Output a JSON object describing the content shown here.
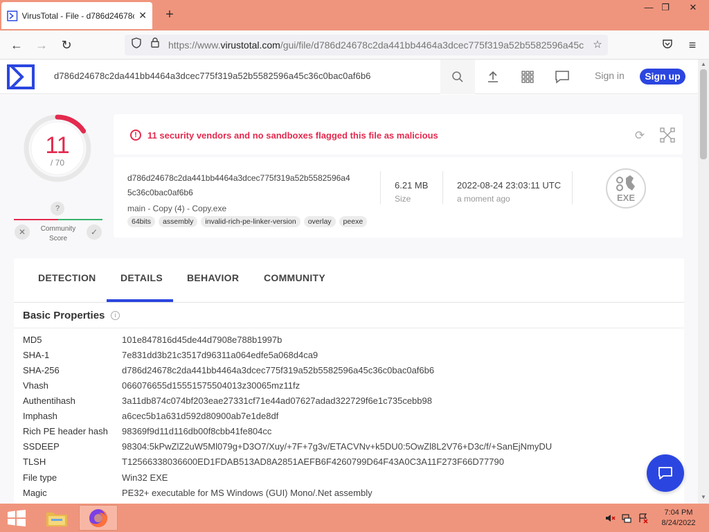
{
  "browser": {
    "tab_title": "VirusTotal - File - d786d24678c2",
    "url_prefix": "https://www.",
    "url_domain": "virustotal.com",
    "url_path": "/gui/file/d786d24678c2da441bb4464a3dcec775f319a52b5582596a45c",
    "window_controls": [
      "—",
      "❐",
      "✕"
    ]
  },
  "header": {
    "search_value": "d786d24678c2da441bb4464a3dcec775f319a52b5582596a45c36c0bac0af6b6",
    "sign_in": "Sign in",
    "sign_up": "Sign up"
  },
  "score": {
    "detections": "11",
    "total": "/ 70",
    "detection_fraction": 0.157,
    "community_question": "?",
    "community_label": "Community Score"
  },
  "alert": {
    "text": "11 security vendors and no sandboxes flagged this file as malicious"
  },
  "file": {
    "hash_line1": "d786d24678c2da441bb4464a3dcec775f319a52b5582596a4",
    "hash_line2": "5c36c0bac0af6b6",
    "name": "main - Copy (4) - Copy.exe",
    "tags": [
      "64bits",
      "assembly",
      "invalid-rich-pe-linker-version",
      "overlay",
      "peexe"
    ],
    "size_value": "6.21 MB",
    "size_label": "Size",
    "date_value": "2022-08-24 23:03:11 UTC",
    "date_label": "a moment ago",
    "type_badge": "EXE"
  },
  "tabs": [
    "DETECTION",
    "DETAILS",
    "BEHAVIOR",
    "COMMUNITY"
  ],
  "active_tab": "DETAILS",
  "basic_properties": {
    "title": "Basic Properties",
    "rows": [
      {
        "key": "MD5",
        "value": "101e847816d45de44d7908e788b1997b"
      },
      {
        "key": "SHA-1",
        "value": "7e831dd3b21c3517d96311a064edfe5a068d4ca9"
      },
      {
        "key": "SHA-256",
        "value": "d786d24678c2da441bb4464a3dcec775f319a52b5582596a45c36c0bac0af6b6"
      },
      {
        "key": "Vhash",
        "value": "066076655d15551575504013z30065mz11fz"
      },
      {
        "key": "Authentihash",
        "value": "3a11db874c074bf203eae27331cf71e44ad07627adad322729f6e1c735cebb98"
      },
      {
        "key": "Imphash",
        "value": "a6cec5b1a631d592d80900ab7e1de8df"
      },
      {
        "key": "Rich PE header hash",
        "value": "98369f9d11d116db00f8cbb41fe804cc"
      },
      {
        "key": "SSDEEP",
        "value": "98304:5kPwZlZ2uW5Ml079g+D3O7/Xuy/+7F+7g3v/ETACVNv+k5DU0:5OwZl8L2V76+D3c/f/+SanEjNmyDU"
      },
      {
        "key": "TLSH",
        "value": "T12566338036600ED1FDAB513AD8A2851AEFB6F4260799D64F43A0C3A11F273F66D77790"
      },
      {
        "key": "File type",
        "value": "Win32 EXE"
      },
      {
        "key": "Magic",
        "value": "PE32+ executable for MS Windows (GUI) Mono/.Net assembly"
      }
    ]
  },
  "taskbar": {
    "time": "7:04 PM",
    "date": "8/24/2022"
  },
  "colors": {
    "accent": "#2b46e0",
    "malicious": "#e32a4e",
    "chrome": "#f0957d"
  }
}
